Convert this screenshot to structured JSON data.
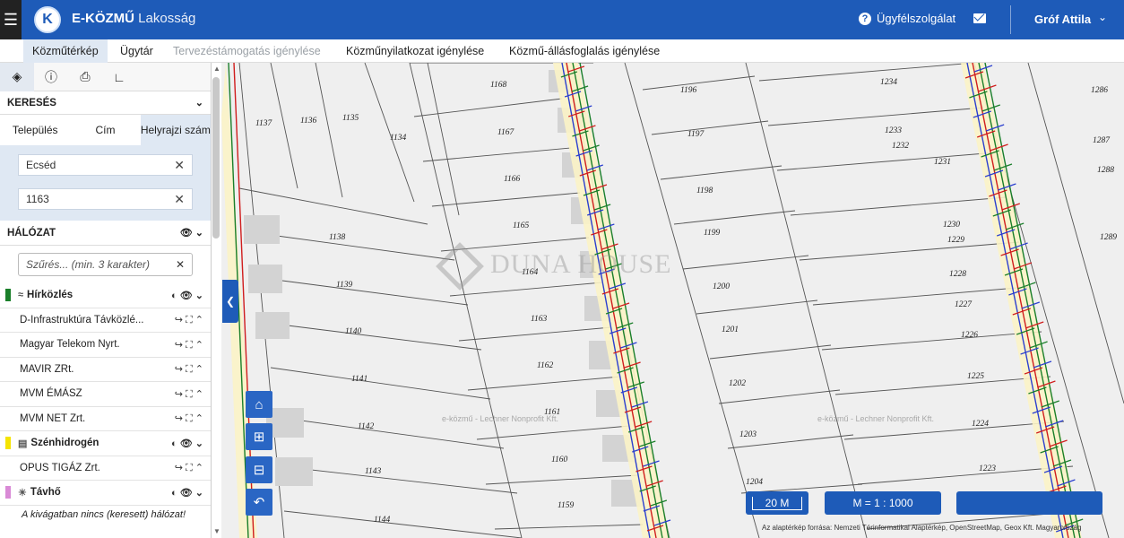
{
  "header": {
    "logo_letter": "K",
    "app_name": "E-KÖZMŰ",
    "app_sub": "Lakosság",
    "help_label": "Ügyfélszolgálat",
    "user_name": "Gróf Attila"
  },
  "nav": {
    "tabs": [
      "Közműtérkép",
      "Ügytár",
      "Tervezéstámogatás igénylése",
      "Közműnyilatkozat igénylése",
      "Közmű-állásfoglalás igénylése"
    ]
  },
  "sidebar": {
    "search_title": "KERESÉS",
    "search_tabs": [
      "Település",
      "Cím",
      "Helyrajzi szám"
    ],
    "settlement_value": "Ecséd",
    "parcel_value": "1163",
    "network_title": "HÁLÓZAT",
    "filter_placeholder": "Szűrés... (min. 3 karakter)",
    "groups": {
      "hirkozles": {
        "label": "Hírközlés",
        "color": "#1a7f2a"
      },
      "szenhidrogen": {
        "label": "Szénhidrogén",
        "color": "#f5e400"
      },
      "tavho": {
        "label": "Távhő",
        "color": "#d98ad6"
      }
    },
    "providers": [
      "D-Infrastruktúra Távközlé...",
      "Magyar Telekom Nyrt.",
      "MAVIR ZRt.",
      "MVM ÉMÁSZ",
      "MVM NET Zrt.",
      "OPUS TIGÁZ Zrt."
    ],
    "empty_note": "A kivágatban nincs (keresett) hálózat!"
  },
  "map": {
    "scale_bar": "20 M",
    "scale_ratio": "M = 1 : 1000",
    "attribution": "Az alaptérkép forrása: Nemzeti Térinformatikai Alaptérkép, OpenStreetMap, Geox Kft. Magyarország",
    "watermark": "DUNA HOUSE",
    "faint_text": "e-közmű - Lechner Nonprofit Kft.",
    "parcels": [
      "1137",
      "1136",
      "1135",
      "1134",
      "1168",
      "1167",
      "1166",
      "1165",
      "1164",
      "1163",
      "1162",
      "1161",
      "1160",
      "1159",
      "1138",
      "1139",
      "1140",
      "1141",
      "1142",
      "1143",
      "1144",
      "1196",
      "1197",
      "1198",
      "1199",
      "1200",
      "1201",
      "1202",
      "1203",
      "1204",
      "1234",
      "1233",
      "1232",
      "1231",
      "1230",
      "1229",
      "1228",
      "1227",
      "1226",
      "1225",
      "1224",
      "1223",
      "1286",
      "1287",
      "1288",
      "1289"
    ]
  }
}
